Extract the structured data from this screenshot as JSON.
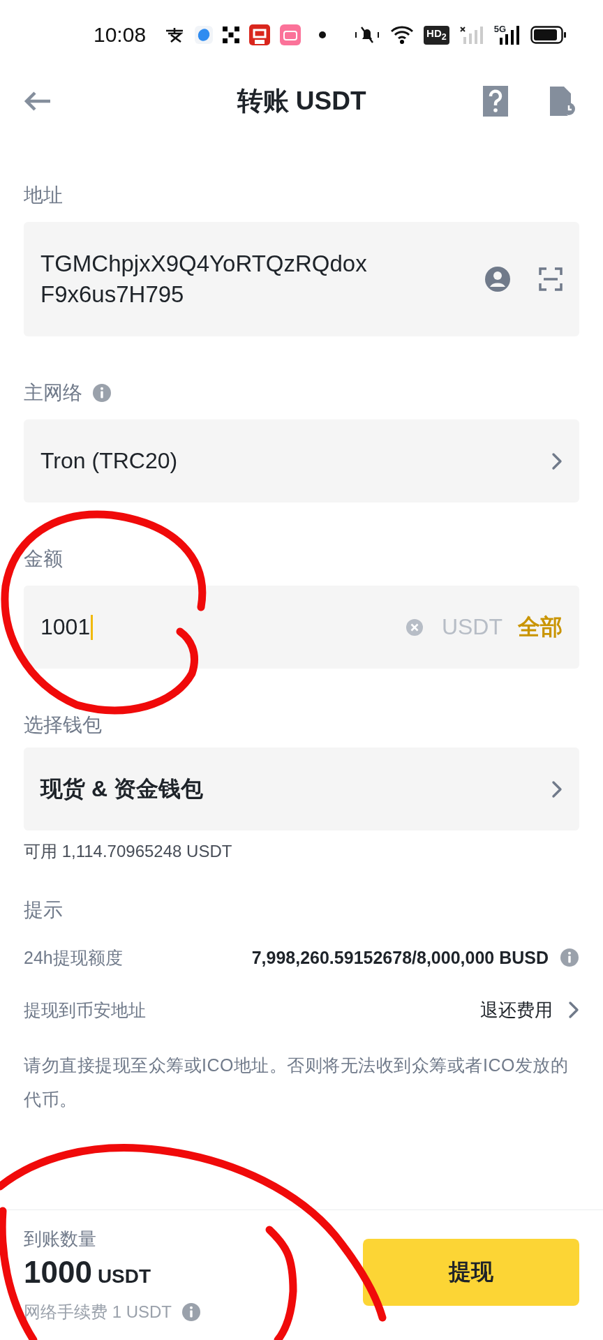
{
  "status_bar": {
    "time": "10:08",
    "hd_badge": "HD$_{2}$",
    "network": "5G"
  },
  "header": {
    "title": "转账 USDT"
  },
  "address": {
    "label": "地址",
    "value": "TGMChpjxX9Q4YoRTQzRQdoxF9x6us7H795"
  },
  "network": {
    "label": "主网络",
    "value": "Tron (TRC20)"
  },
  "amount": {
    "label": "金额",
    "value": "1001",
    "focused": true,
    "unit": "USDT",
    "max_button": "全部"
  },
  "wallet": {
    "label": "选择钱包",
    "value": "现货 & 资金钱包",
    "available": "可用 1,114.70965248 USDT"
  },
  "tips": {
    "title": "提示",
    "rows": [
      {
        "label": "24h提现额度",
        "value": "7,998,260.59152678/8,000,000 BUSD",
        "kind": "info"
      },
      {
        "label": "提现到币安地址",
        "value": "退还费用",
        "kind": "link"
      }
    ],
    "notice": "请勿直接提现至众筹或ICO地址。否则将无法收到众筹或者ICO发放的代币。"
  },
  "footer": {
    "label": "到账数量",
    "amount": "1000",
    "unit": "USDT",
    "fee": "网络手续费 1 USDT",
    "button": "提现"
  },
  "annotations": [
    {
      "kind": "loop"
    },
    {
      "kind": "loop"
    }
  ]
}
